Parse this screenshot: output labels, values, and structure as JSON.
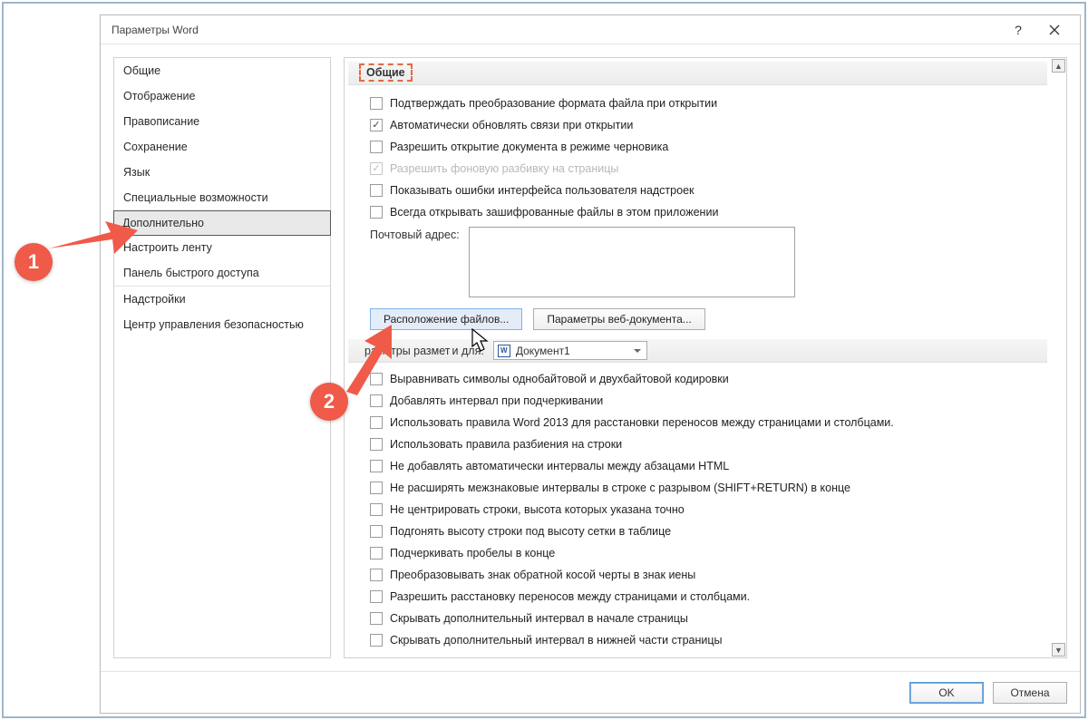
{
  "window": {
    "title": "Параметры Word",
    "help": "?",
    "close": "✕"
  },
  "sidebar": {
    "items": [
      "Общие",
      "Отображение",
      "Правописание",
      "Сохранение",
      "Язык",
      "Специальные возможности",
      "Дополнительно",
      "Настроить ленту",
      "Панель быстрого доступа",
      "Надстройки",
      "Центр управления безопасностью"
    ],
    "selected_index": 6
  },
  "section1": {
    "title": "Общие",
    "opts": [
      {
        "label": "Подтверждать преобразование формата файла при открытии",
        "checked": false
      },
      {
        "label": "Автоматически обновлять связи при открытии",
        "checked": true
      },
      {
        "label": "Разрешить открытие документа в режиме черновика",
        "checked": false
      },
      {
        "label": "Разрешить фоновую разбивку на страницы",
        "checked": true,
        "disabled": true
      },
      {
        "label": "Показывать ошибки интерфейса пользователя надстроек",
        "checked": false
      },
      {
        "label": "Всегда открывать зашифрованные файлы в этом приложении",
        "checked": false
      }
    ],
    "mail_label": "Почтовый адрес:"
  },
  "buttons": {
    "file_locations": "Расположение файлов...",
    "web_options": "Параметры веб-документа..."
  },
  "section2": {
    "title_prefix": "раметры размет",
    "title_suffix": "и для:",
    "document": "Документ1",
    "opts": [
      "Выравнивать символы однобайтовой и двухбайтовой кодировки",
      "Добавлять интервал при подчеркивании",
      "Использовать правила Word 2013 для расстановки переносов между страницами и столбцами.",
      "Использовать правила разбиения на строки",
      "Не добавлять автоматически интервалы между абзацами HTML",
      "Не расширять межзнаковые интервалы в строке с разрывом (SHIFT+RETURN) в конце",
      "Не центрировать строки, высота которых указана точно",
      "Подгонять высоту строки под высоту сетки в таблице",
      "Подчеркивать пробелы в конце",
      "Преобразовывать знак обратной косой черты в знак иены",
      "Разрешить расстановку переносов между страницами и столбцами.",
      "Скрывать дополнительный интервал в начале страницы",
      "Скрывать дополнительный интервал в нижней части страницы"
    ]
  },
  "footer": {
    "ok": "OK",
    "cancel": "Отмена"
  },
  "annotations": {
    "badge1": "1",
    "badge2": "2"
  }
}
